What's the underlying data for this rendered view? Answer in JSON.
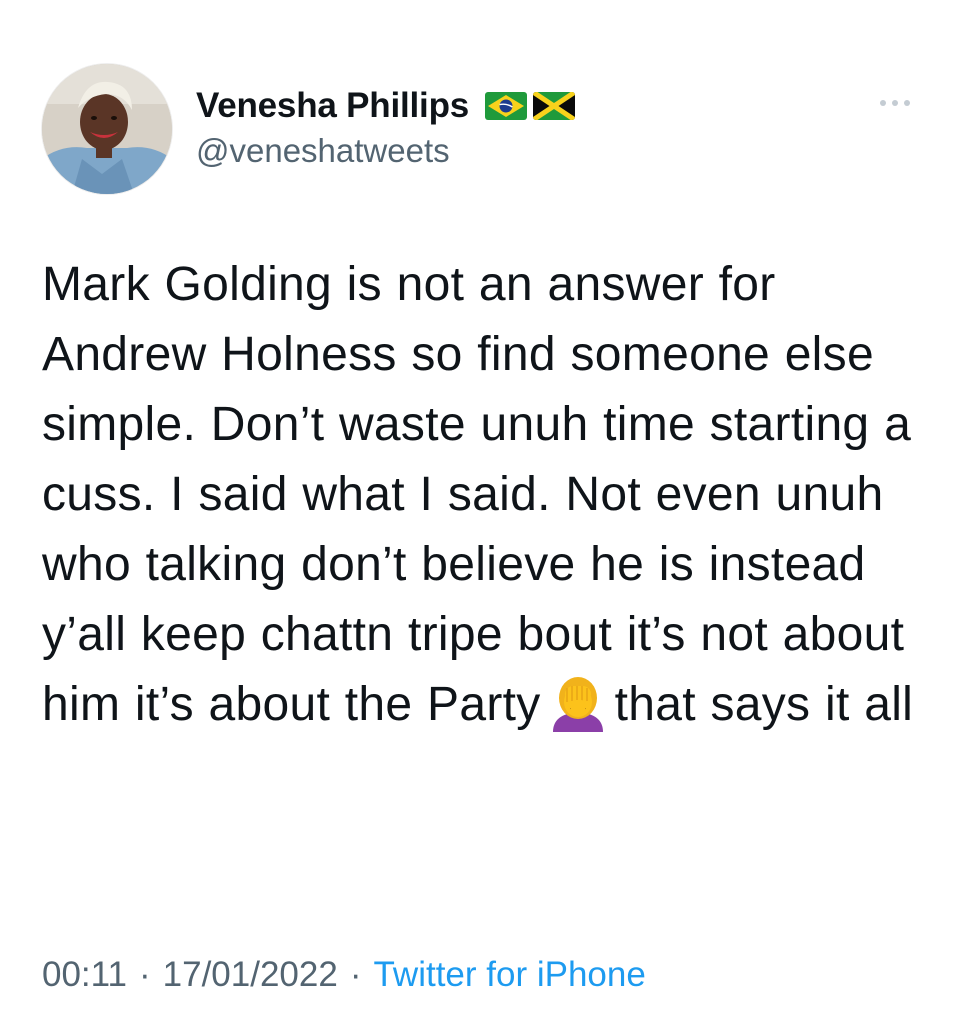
{
  "author": {
    "display_name": "Venesha Phillips",
    "handle": "@veneshatweets",
    "flags": [
      "brazil-flag-icon",
      "jamaica-flag-icon"
    ]
  },
  "tweet": {
    "text_before_emoji": "Mark Golding is not an answer for Andrew Holness so find someone else simple. Don’t waste unuh time starting a cuss. I said what I said. Not even unuh who talking don’t believe he is instead y’all keep chattn tripe bout it’s not about him it’s about the Party",
    "emoji": "woman-facepalming-icon",
    "text_after_emoji": "that says it all"
  },
  "meta": {
    "time": "00:11",
    "date": "17/01/2022",
    "separator": "·",
    "source": "Twitter for iPhone"
  },
  "icons": {
    "more": "more-options-icon"
  },
  "colors": {
    "text": "#0f1419",
    "secondary": "#536471",
    "link": "#1d9bf0"
  }
}
